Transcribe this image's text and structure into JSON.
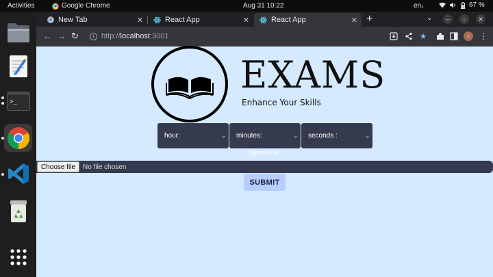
{
  "topbar": {
    "activities": "Activities",
    "app_name": "Google Chrome",
    "clock": "Aug 31  10:22",
    "language": "en₁",
    "battery": "67 %"
  },
  "dock": {
    "items": [
      "files",
      "text-editor",
      "terminal",
      "chrome",
      "vscode",
      "trash",
      "app-grid"
    ]
  },
  "browser": {
    "tabs": [
      {
        "label": "New Tab",
        "icon": "chrome-icon"
      },
      {
        "label": "React App",
        "icon": "react-icon"
      },
      {
        "label": "React App",
        "icon": "react-icon"
      }
    ],
    "url_prefix": "http://",
    "url_host": "localhost",
    "url_port": ":3001"
  },
  "page": {
    "title": "EXAMS",
    "subtitle": "Enhance Your Skills",
    "selects": {
      "hour": "hour:",
      "minutes": "minutes:",
      "seconds": "seconds :"
    },
    "upload_label": "Upload File",
    "file_button": "Choose file",
    "file_status": "No file chosen",
    "submit": "SUBMIT"
  },
  "colors": {
    "page_bg": "#d6eaff",
    "select_bg": "#363a4e",
    "submit_bg": "#b7cdfd"
  }
}
